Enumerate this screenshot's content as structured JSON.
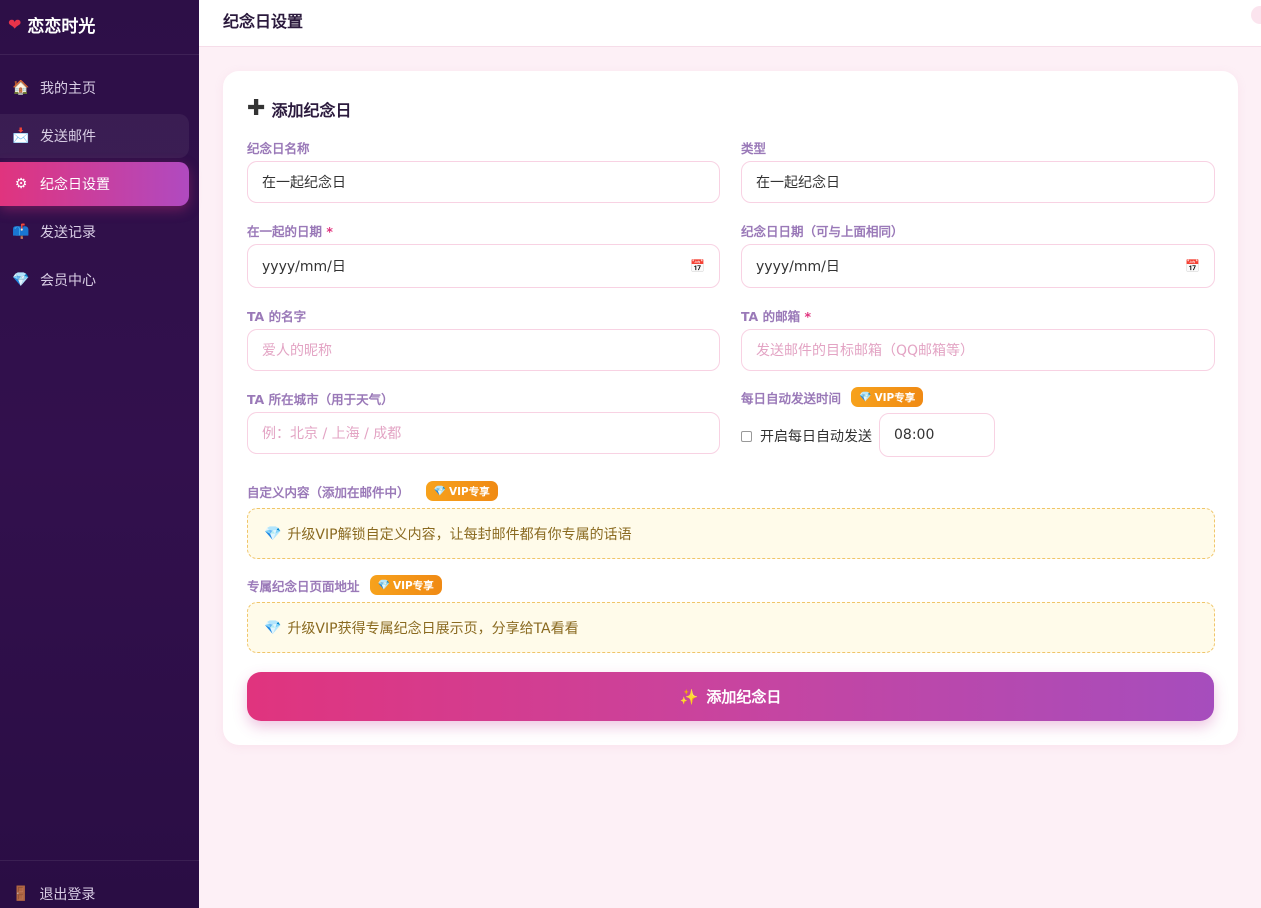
{
  "sidebar": {
    "brand": "恋恋时光",
    "items": [
      {
        "label": "我的主页",
        "icon": "home-icon",
        "glyph": "🏠"
      },
      {
        "label": "发送邮件",
        "icon": "mail-icon",
        "glyph": "📩"
      },
      {
        "label": "纪念日设置",
        "icon": "gear-icon",
        "glyph": "⚙"
      },
      {
        "label": "发送记录",
        "icon": "mailbox-icon",
        "glyph": "📫"
      },
      {
        "label": "会员中心",
        "icon": "diamond-icon",
        "glyph": "💎"
      }
    ],
    "active_index": 2,
    "logout": "退出登录"
  },
  "header": {
    "title": "纪念日设置"
  },
  "form": {
    "title": "添加纪念日",
    "name_label": "纪念日名称",
    "name_value": "在一起纪念日",
    "type_label": "类型",
    "type_value": "在一起纪念日",
    "together_date_label": "在一起的日期",
    "required_mark": "*",
    "together_date_placeholder": "yyyy/mm/日",
    "anniversary_date_label": "纪念日日期（可与上面相同）",
    "anniversary_date_placeholder": "yyyy/mm/日",
    "ta_name_label": "TA 的名字",
    "ta_name_placeholder": "爱人的昵称",
    "ta_email_label": "TA 的邮箱",
    "ta_email_placeholder": "发送邮件的目标邮箱（QQ邮箱等）",
    "ta_city_label": "TA 所在城市（用于天气）",
    "ta_city_placeholder": "例：北京 / 上海 / 成都",
    "auto_send_label": "每日自动发送时间",
    "auto_send_checkbox": "开启每日自动发送",
    "auto_send_time": "08:00",
    "vip_badge": "VIP专享",
    "custom_content_label": "自定义内容（添加在邮件中）",
    "custom_content_notice": "升级VIP解锁自定义内容，让每封邮件都有你专属的话语",
    "page_url_label": "专属纪念日页面地址",
    "page_url_notice": "升级VIP获得专属纪念日展示页，分享给TA看看",
    "submit": "添加纪念日"
  }
}
